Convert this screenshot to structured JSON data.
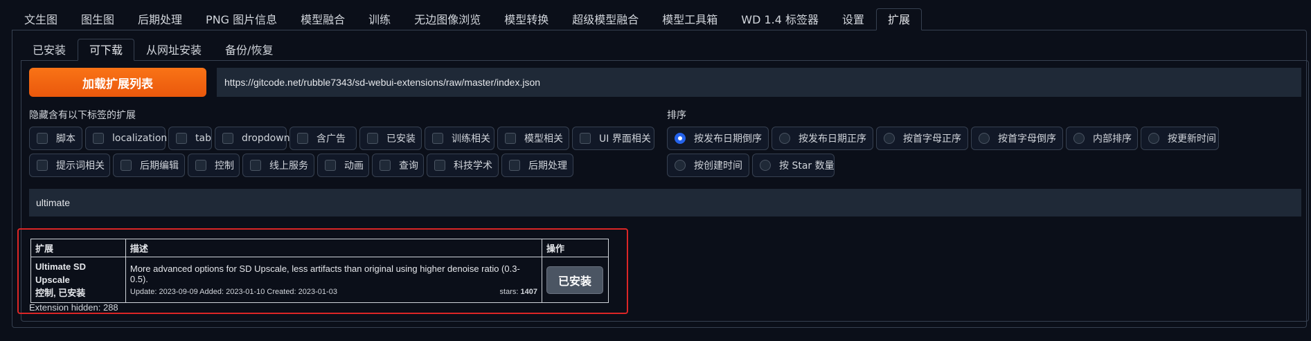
{
  "top_tabs": [
    "文生图",
    "图生图",
    "后期处理",
    "PNG 图片信息",
    "模型融合",
    "训练",
    "无边图像浏览",
    "模型转换",
    "超级模型融合",
    "模型工具箱",
    "WD 1.4 标签器",
    "设置",
    "扩展"
  ],
  "active_top_tab": "扩展",
  "sub_tabs": [
    "已安装",
    "可下载",
    "从网址安装",
    "备份/恢复"
  ],
  "active_sub_tab": "可下载",
  "load_button": "加载扩展列表",
  "index_url": "https://gitcode.net/rubble7343/sd-webui-extensions/raw/master/index.json",
  "hide_tags": {
    "label": "隐藏含有以下标签的扩展",
    "options": [
      "脚本",
      "localization",
      "tab",
      "dropdown",
      "含广告",
      "已安装",
      "训练相关",
      "模型相关",
      "UI 界面相关",
      "提示词相关",
      "后期编辑",
      "控制",
      "线上服务",
      "动画",
      "查询",
      "科技学术",
      "后期处理"
    ]
  },
  "sort": {
    "label": "排序",
    "options": [
      "按发布日期倒序",
      "按发布日期正序",
      "按首字母正序",
      "按首字母倒序",
      "内部排序",
      "按更新时间",
      "按创建时间",
      "按 Star 数量"
    ],
    "selected": "按发布日期倒序"
  },
  "search_value": "ultimate",
  "table": {
    "headers": [
      "扩展",
      "描述",
      "操作"
    ],
    "rows": [
      {
        "name_line1": "Ultimate SD Upscale",
        "name_line2": "控制, 已安装",
        "description": "More advanced options for SD Upscale, less artifacts than original using higher denoise ratio (0.3-0.5).",
        "dates": "Update: 2023-09-09 Added: 2023-01-10 Created: 2023-01-03",
        "stars_label": "stars:",
        "stars": "1407",
        "action": "已安装"
      }
    ]
  },
  "hidden_info": "Extension hidden: 288"
}
